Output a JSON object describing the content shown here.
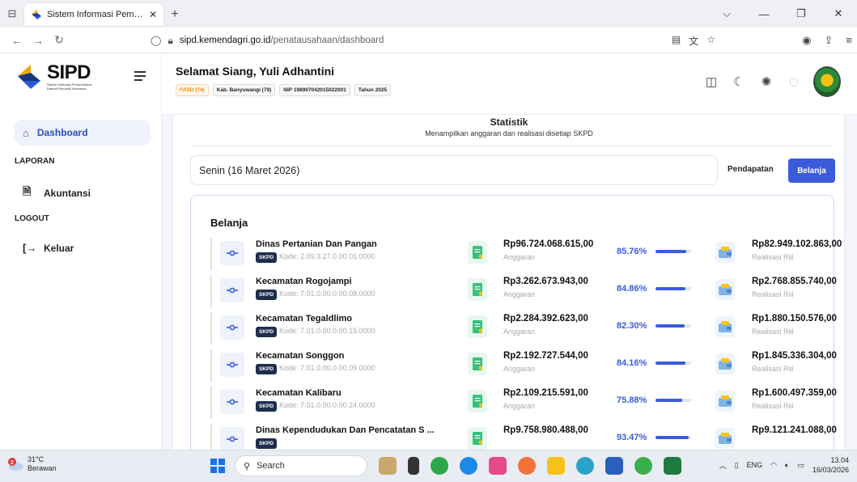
{
  "browser": {
    "tab_title": "Sistem Informasi Pemerintahan",
    "url_domain": "sipd.kemendagri.go.id",
    "url_path": "/penatausahaan/dashboard"
  },
  "sidebar": {
    "logo_text": "SIPD",
    "logo_sub": "Sistem Informasi Pemerintahan Daerah Republik Indonesia",
    "active_item": "Dashboard",
    "section_laporan": "LAPORAN",
    "item_akuntansi": "Akuntansi",
    "section_logout": "LOGOUT",
    "item_keluar": "Keluar"
  },
  "header": {
    "greeting": "Selamat Siang, Yuli Adhantini",
    "badges": [
      "FASD (74)",
      "Kab. Banyuwangi (79)",
      "NIP 198907042015022001",
      "Tahun 2025"
    ]
  },
  "stat": {
    "title": "Statistik",
    "subtitle": "Menampilkan anggaran dan realisasi disetiap SKPD",
    "date": "Senin (16 Maret 2026)",
    "btn_pendapatan": "Pendapatan",
    "btn_belanja": "Belanja",
    "panel_title": "Belanja"
  },
  "rows": [
    {
      "name": "Dinas Pertanian Dan Pangan",
      "tag": "SKPD",
      "kode": "Kode: 2.09.3.27.0.00.01.0000",
      "anggaran": "Rp96.724.068.615,00",
      "anggaran_label": "Anggaran",
      "pct": "85.76%",
      "pct_value": 0.8576,
      "realisasi": "Rp82.949.102.863,00",
      "realisasi_label": "Realisasi Riil"
    },
    {
      "name": "Kecamatan Rogojampi",
      "tag": "SKPD",
      "kode": "Kode: 7.01.0.00.0.00.08.0000",
      "anggaran": "Rp3.262.673.943,00",
      "anggaran_label": "Anggaran",
      "pct": "84.86%",
      "pct_value": 0.8486,
      "realisasi": "Rp2.768.855.740,00",
      "realisasi_label": "Realisasi Riil"
    },
    {
      "name": "Kecamatan Tegaldlimo",
      "tag": "SKPD",
      "kode": "Kode: 7.01.0.00.0.00.15.0000",
      "anggaran": "Rp2.284.392.623,00",
      "anggaran_label": "Anggaran",
      "pct": "82.30%",
      "pct_value": 0.823,
      "realisasi": "Rp1.880.150.576,00",
      "realisasi_label": "Realisasi Riil"
    },
    {
      "name": "Kecamatan Songgon",
      "tag": "SKPD",
      "kode": "Kode: 7.01.0.00.0.00.09.0000",
      "anggaran": "Rp2.192.727.544,00",
      "anggaran_label": "Anggaran",
      "pct": "84.16%",
      "pct_value": 0.8416,
      "realisasi": "Rp1.845.336.304,00",
      "realisasi_label": "Realisasi Riil"
    },
    {
      "name": "Kecamatan Kalibaru",
      "tag": "SKPD",
      "kode": "Kode: 7.01.0.00.0.00.24.0000",
      "anggaran": "Rp2.109.215.591,00",
      "anggaran_label": "Anggaran",
      "pct": "75.88%",
      "pct_value": 0.7588,
      "realisasi": "Rp1.600.497.359,00",
      "realisasi_label": "Realisasi Riil"
    },
    {
      "name": "Dinas Kependudukan Dan Pencatatan S ...",
      "tag": "SKPD",
      "kode": "",
      "anggaran": "Rp9.758.980.488,00",
      "anggaran_label": "",
      "pct": "93.47%",
      "pct_value": 0.9347,
      "realisasi": "Rp9.121.241.088,00",
      "realisasi_label": ""
    }
  ],
  "taskbar": {
    "temp": "31°C",
    "weather": "Berawan",
    "weather_badge": "2",
    "search": "Search",
    "lang": "ENG",
    "time": "13.04",
    "date": "16/03/2026"
  },
  "colors": {
    "accent": "#3b5bdb",
    "active_bg": "#eef2fb",
    "sidebar_active_text": "#2d4fb8"
  }
}
